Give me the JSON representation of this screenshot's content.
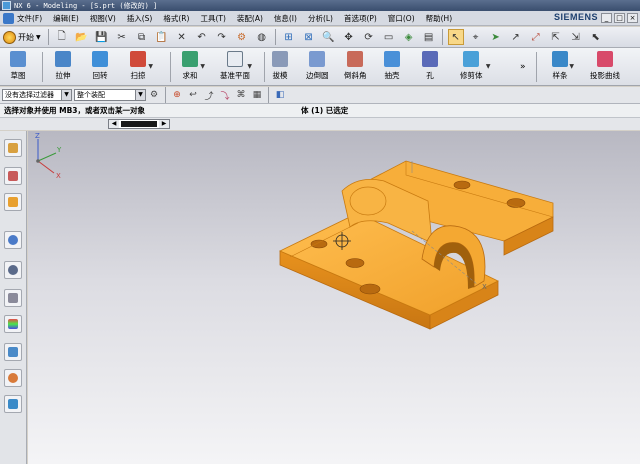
{
  "window": {
    "title": "NX 6 - Modeling - [S.prt (修改的) ]"
  },
  "menubar": {
    "items": [
      "文件(F)",
      "编辑(E)",
      "视图(V)",
      "插入(S)",
      "格式(R)",
      "工具(T)",
      "装配(A)",
      "信息(I)",
      "分析(L)",
      "首选项(P)",
      "窗口(O)",
      "帮助(H)"
    ],
    "brand": "SIEMENS",
    "window_buttons": [
      "_",
      "□",
      "×"
    ]
  },
  "standard_toolbar": {
    "start_label": "开始",
    "start_arrow": "▼"
  },
  "feature_toolbar": {
    "buttons": [
      {
        "label": "草图",
        "color": "#5a8fd0",
        "has_menu": false
      },
      {
        "label": "拉伸",
        "color": "#4a86c8",
        "has_menu": false
      },
      {
        "label": "回转",
        "color": "#3f8fd8",
        "has_menu": false
      },
      {
        "label": "扫掠",
        "color": "#d04a3a",
        "has_menu": true
      },
      {
        "label": "求和",
        "color": "#3aa070",
        "has_menu": true
      },
      {
        "label": "基准平面",
        "color": "#e8ecf2",
        "has_menu": true
      },
      {
        "label": "拔模",
        "color": "#8a9ab8",
        "has_menu": false
      },
      {
        "label": "边倒圆",
        "color": "#7a9ad0",
        "has_menu": false
      },
      {
        "label": "倒斜角",
        "color": "#c86a5a",
        "has_menu": false
      },
      {
        "label": "抽壳",
        "color": "#4a90d8",
        "has_menu": false
      },
      {
        "label": "孔",
        "color": "#5a6ab8",
        "has_menu": false
      },
      {
        "label": "修剪体",
        "color": "#4aa0d8",
        "has_menu": true
      },
      {
        "label": "样条",
        "color": "#3a88c8",
        "has_menu": true
      },
      {
        "label": "投影曲线",
        "color": "#d84a6a",
        "has_menu": true
      }
    ],
    "overflow_arrow": "»"
  },
  "selection_bar": {
    "type_filter": "没有选择过滤器",
    "scope": "整个装配"
  },
  "cue_line": {
    "prompt": "选择对象并使用 MB3，或者双击某一对象",
    "status": "体 (1) 已选定"
  },
  "resource_scroll": {
    "left_arrow": "◀",
    "right_arrow": "▶"
  },
  "triad": {
    "x_label": "X",
    "y_label": "Y",
    "z_label": "Z"
  },
  "model_axes": {
    "x_label": "X"
  },
  "colors": {
    "model_fill": "#f5a623",
    "model_edge": "#c87a10",
    "selection_highlight": "#f0b040"
  }
}
